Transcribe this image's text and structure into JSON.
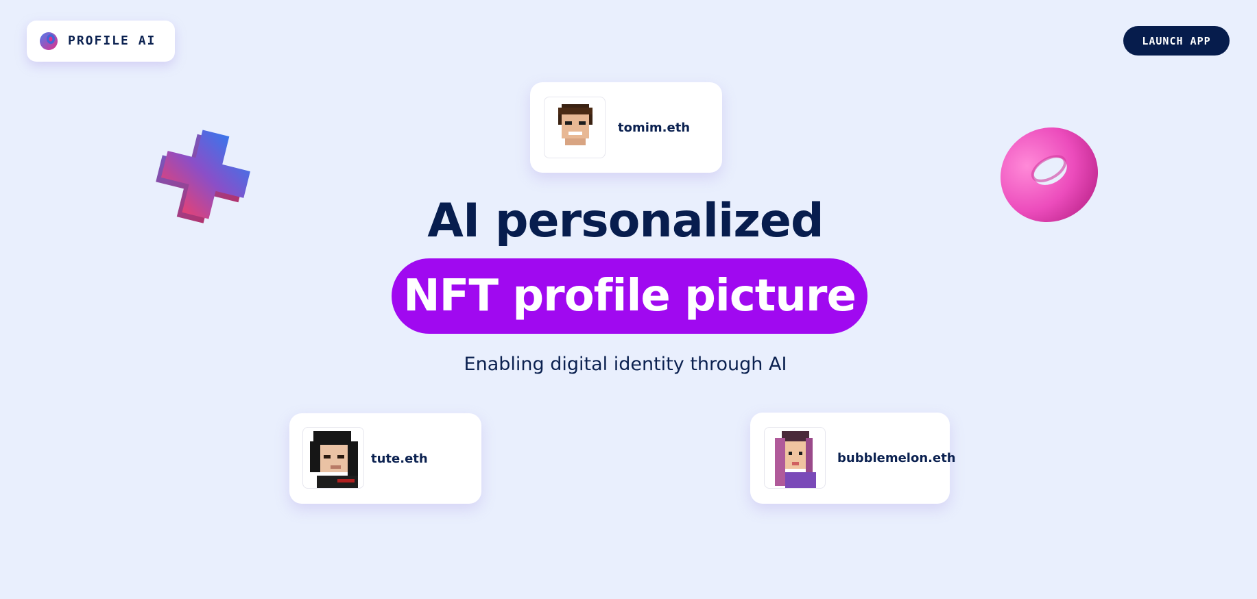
{
  "header": {
    "logo_text": "PROFILE AI",
    "logo_icon": "profile-ai-logo-icon",
    "launch_label": "LAUNCH APP"
  },
  "hero": {
    "headline": "AI personalized",
    "highlight": "NFT profile picture",
    "subtitle": "Enabling digital identity through AI"
  },
  "profiles": [
    {
      "name": "tomim.eth",
      "avatar_icon": "pixel-avatar-brown-hair-man"
    },
    {
      "name": "tute.eth",
      "avatar_icon": "pixel-avatar-black-hair-man"
    },
    {
      "name": "bubblemelon.eth",
      "avatar_icon": "pixel-avatar-pink-hair-woman"
    }
  ],
  "decorations": {
    "left": "3d-plus-shape",
    "right": "3d-pink-torus"
  },
  "colors": {
    "background": "#e9effd",
    "navy": "#071d4e",
    "accent_purple": "#a009f0",
    "button_bg": "#061c4c"
  }
}
